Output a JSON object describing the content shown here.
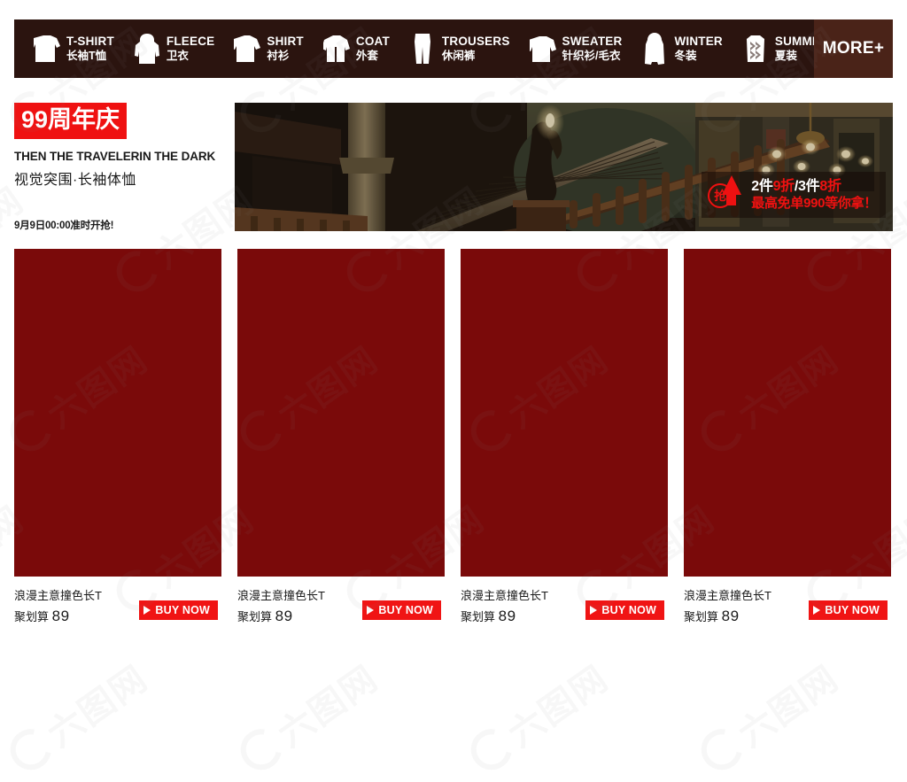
{
  "nav": {
    "items": [
      {
        "icon": "tshirt-icon",
        "en": "T-SHIRT",
        "cn": "长袖T恤"
      },
      {
        "icon": "fleece-icon",
        "en": "FLEECE",
        "cn": "卫衣"
      },
      {
        "icon": "shirt-icon",
        "en": "SHIRT",
        "cn": "衬衫"
      },
      {
        "icon": "coat-icon",
        "en": "COAT",
        "cn": "外套"
      },
      {
        "icon": "trousers-icon",
        "en": "TROUSERS",
        "cn": "休闲裤"
      },
      {
        "icon": "sweater-icon",
        "en": "SWEATER",
        "cn": "针织衫/毛衣"
      },
      {
        "icon": "winter-icon",
        "en": "WINTER",
        "cn": "冬装"
      },
      {
        "icon": "summer-icon",
        "en": "SUMMER",
        "cn": "夏装"
      }
    ],
    "more_label": "MORE+",
    "bg_color": "#2b140f",
    "more_bg_color": "#4a2318"
  },
  "promo": {
    "badge": "99周年庆",
    "badge_color": "#ef1111",
    "headline_en": "THEN THE TRAVELERIN THE DARK",
    "headline_cn": "视觉突围·长袖体恤",
    "date_note": "9月9日00:00准时开抢!"
  },
  "hero": {
    "alt": "ornate-grand-staircase-interior",
    "badge": {
      "icon_char": "抢",
      "line1_part1": "2件",
      "line1_discount1": "9折",
      "line1_sep": "/3件",
      "line1_discount2": "8折",
      "line2": "最高免单990等你拿！",
      "accent_color": "#ef1111"
    }
  },
  "products": [
    {
      "title": "浪漫主意撞色长T",
      "price_label": "聚划算",
      "price": "89",
      "buy_label": "BUY NOW",
      "image_color": "#7a0a0a"
    },
    {
      "title": "浪漫主意撞色长T",
      "price_label": "聚划算",
      "price": "89",
      "buy_label": "BUY NOW",
      "image_color": "#7a0a0a"
    },
    {
      "title": "浪漫主意撞色长T",
      "price_label": "聚划算",
      "price": "89",
      "buy_label": "BUY NOW",
      "image_color": "#7a0a0a"
    },
    {
      "title": "浪漫主意撞色长T",
      "price_label": "聚划算",
      "price": "89",
      "buy_label": "BUY NOW",
      "image_color": "#7a0a0a"
    }
  ],
  "watermark": {
    "text": "六图网"
  }
}
